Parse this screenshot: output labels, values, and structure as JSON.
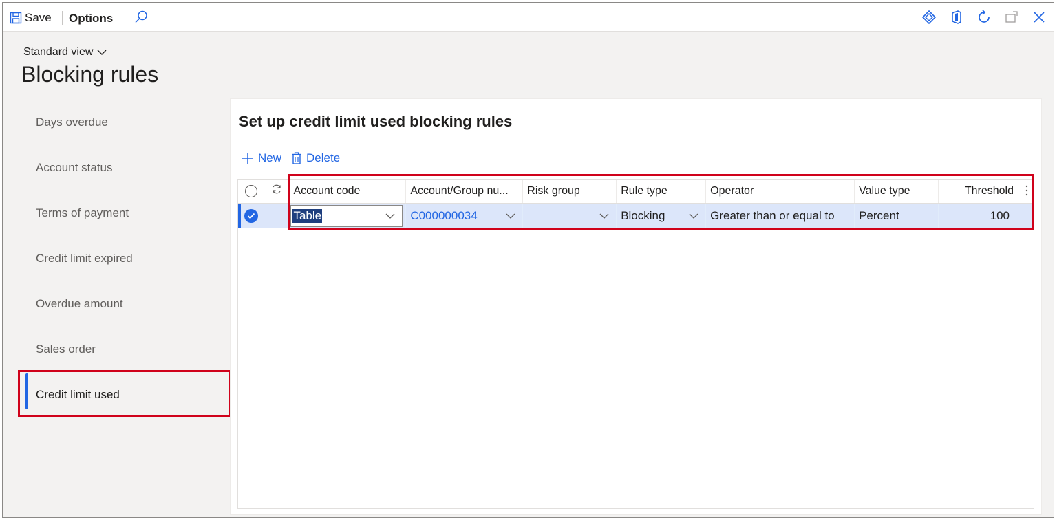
{
  "commandbar": {
    "save_label": "Save",
    "options_label": "Options"
  },
  "header": {
    "view_label": "Standard view",
    "title": "Blocking rules"
  },
  "nav": {
    "items": [
      {
        "label": "Days overdue"
      },
      {
        "label": "Account status"
      },
      {
        "label": "Terms of payment"
      },
      {
        "label": "Credit limit expired"
      },
      {
        "label": "Overdue amount"
      },
      {
        "label": "Sales order"
      },
      {
        "label": "Credit limit used"
      }
    ],
    "active_index": 6
  },
  "panel": {
    "title": "Set up credit limit used blocking rules",
    "new_label": "New",
    "delete_label": "Delete"
  },
  "grid": {
    "columns": [
      "Account code",
      "Account/Group nu...",
      "Risk group",
      "Rule type",
      "Operator",
      "Value type",
      "Threshold"
    ],
    "rows": [
      {
        "account_code": "Table",
        "account_group": "C000000034",
        "risk_group": "",
        "rule_type": "Blocking",
        "operator": "Greater than or equal to",
        "value_type": "Percent",
        "threshold": "100"
      }
    ]
  },
  "colors": {
    "accent": "#2266e3",
    "highlight": "#d0021b",
    "selected_row": "#dce6fa"
  }
}
